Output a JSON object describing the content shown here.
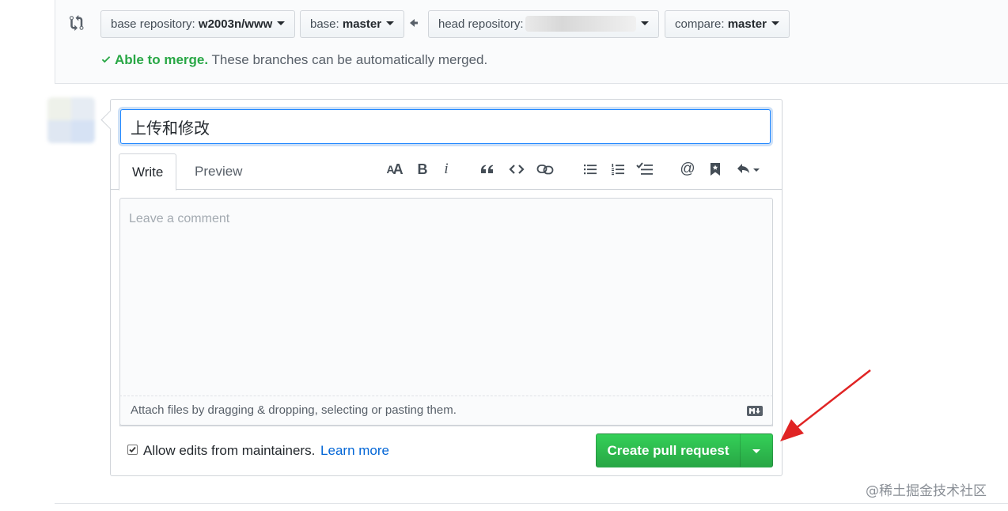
{
  "compare_bar": {
    "base_repository": {
      "prefix": "base repository:",
      "value": "w2003n/www"
    },
    "base": {
      "prefix": "base:",
      "value": "master"
    },
    "head_repository": {
      "prefix": "head repository:"
    },
    "compare": {
      "prefix": "compare:",
      "value": "master"
    },
    "icons": {
      "compare": "git-compare-icon",
      "direction": "arrow-left-icon"
    }
  },
  "merge_status": {
    "ok_text": "Able to merge.",
    "message": " These branches can be automatically merged.",
    "status_color": "#28a745"
  },
  "composer": {
    "title_value": "上传和修改",
    "tabs": [
      {
        "label": "Write",
        "selected": true
      },
      {
        "label": "Preview",
        "selected": false
      }
    ],
    "toolbar": [
      {
        "name": "text-size-icon",
        "glyph": "AA"
      },
      {
        "name": "bold-icon",
        "glyph": "B"
      },
      {
        "name": "italic-icon",
        "glyph": "i"
      },
      {
        "name": "quote-icon",
        "glyph": "❝"
      },
      {
        "name": "code-icon",
        "glyph": "<>"
      },
      {
        "name": "link-icon",
        "glyph": ""
      },
      {
        "name": "unordered-list-icon",
        "glyph": ""
      },
      {
        "name": "ordered-list-icon",
        "glyph": ""
      },
      {
        "name": "task-list-icon",
        "glyph": ""
      },
      {
        "name": "mention-icon",
        "glyph": "@"
      },
      {
        "name": "bookmark-icon",
        "glyph": ""
      },
      {
        "name": "reply-icon",
        "glyph": ""
      }
    ],
    "comment_placeholder": "Leave a comment",
    "attach_text": "Attach files by dragging & dropping, selecting or pasting them.",
    "allow_edits_label": "Allow edits from maintainers.",
    "allow_edits_checked": true,
    "learn_more": "Learn more",
    "create_button": "Create pull request"
  },
  "watermark": "@稀土掘金技术社区",
  "colors": {
    "accent_blue": "#0366d6",
    "button_green": "#28a745",
    "annotation_red": "#e02424"
  }
}
